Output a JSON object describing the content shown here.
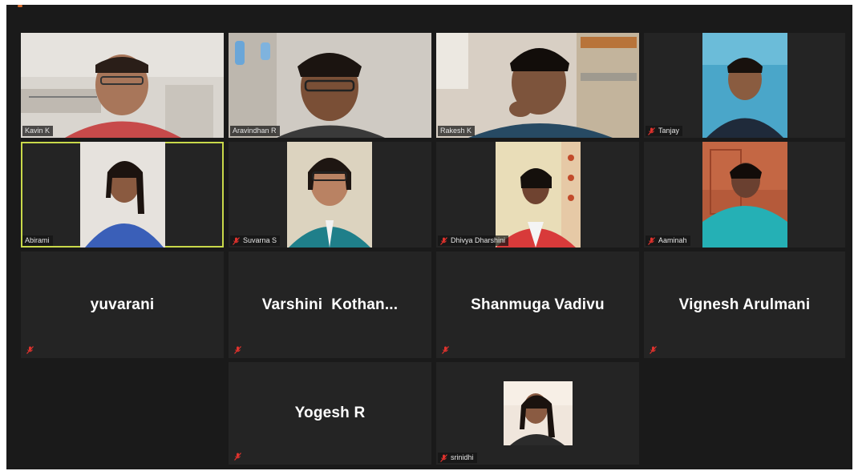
{
  "colors": {
    "background": "#1a1a1a",
    "tile": "#242424",
    "active_border": "#c9d94a",
    "mute_icon": "#e0322d",
    "name_text": "#ffffff"
  },
  "participants": [
    {
      "name": "Kavin K",
      "video": true,
      "muted": false
    },
    {
      "name": "Aravindhan R",
      "video": true,
      "muted": false
    },
    {
      "name": "Rakesh K",
      "video": true,
      "muted": false
    },
    {
      "name": "Tanjay",
      "video": true,
      "muted": true
    },
    {
      "name": "Abirami",
      "video": true,
      "muted": false,
      "active_speaker": true
    },
    {
      "name": "Suvarna S",
      "video": true,
      "muted": true
    },
    {
      "name": "Dhivya Dharshini",
      "video": true,
      "muted": true
    },
    {
      "name": "Aaminah",
      "video": true,
      "muted": true
    },
    {
      "name": "yuvarani",
      "video": false,
      "muted": true
    },
    {
      "name": "Varshini  Kothan...",
      "video": false,
      "muted": true
    },
    {
      "name": "Shanmuga Vadivu",
      "video": false,
      "muted": true
    },
    {
      "name": "Vignesh Arulmani",
      "video": false,
      "muted": true
    },
    {
      "name": "Yogesh R",
      "video": false,
      "muted": true
    },
    {
      "name": "srinidhi",
      "video": true,
      "muted": true
    }
  ]
}
